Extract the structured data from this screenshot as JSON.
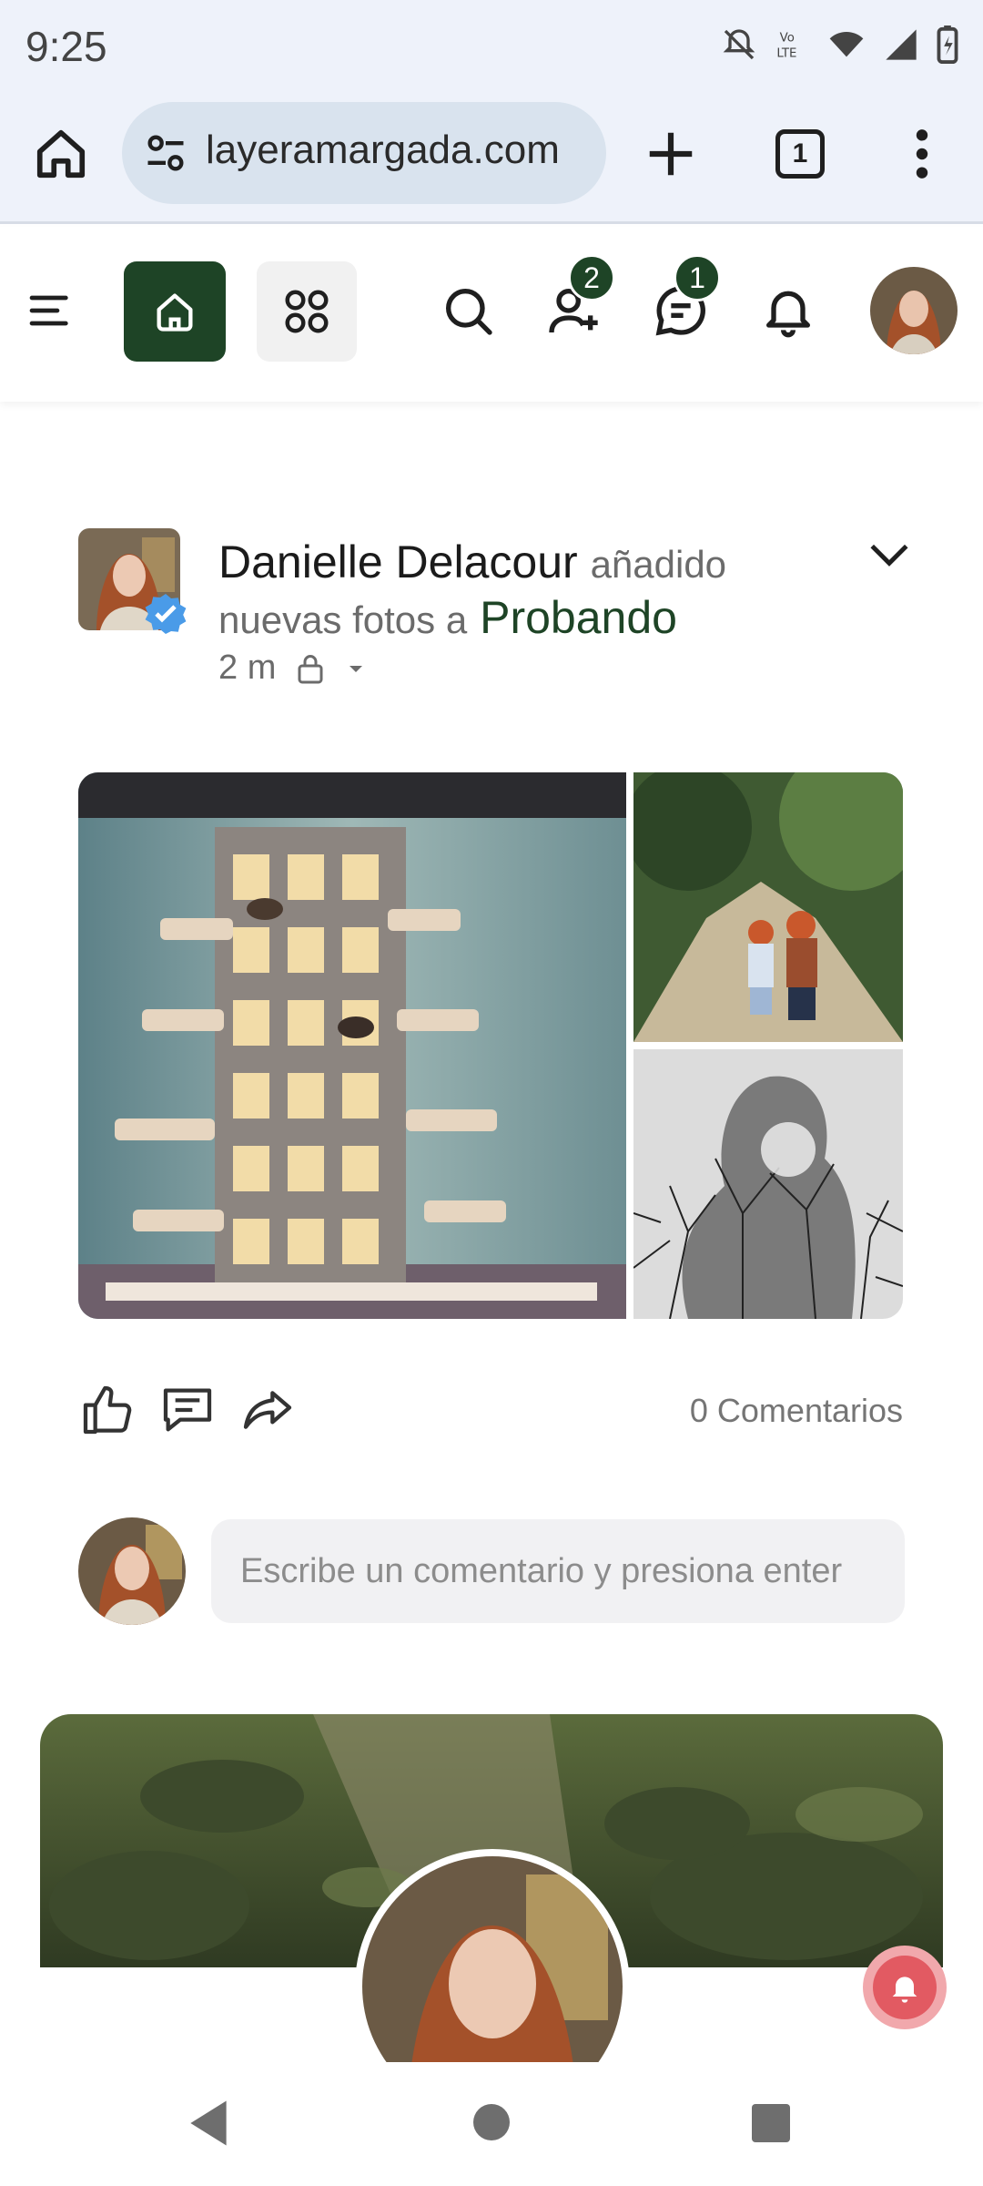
{
  "status_bar": {
    "time": "9:25"
  },
  "browser": {
    "url": "layeramargada.com",
    "tab_count": "1"
  },
  "header": {
    "friend_requests_badge": "2",
    "messages_badge": "1"
  },
  "post": {
    "author": "Danielle Delacour",
    "action_text": "añadido nuevas fotos a",
    "group": "Probando",
    "time_ago": "2 m",
    "comments_count": "0 Comentarios"
  },
  "comment": {
    "placeholder": "Escribe un comentario y presiona enter"
  },
  "colors": {
    "brand_green": "#1e4426",
    "browser_bg": "#eef2fa",
    "url_pill": "#d9e3ee"
  }
}
